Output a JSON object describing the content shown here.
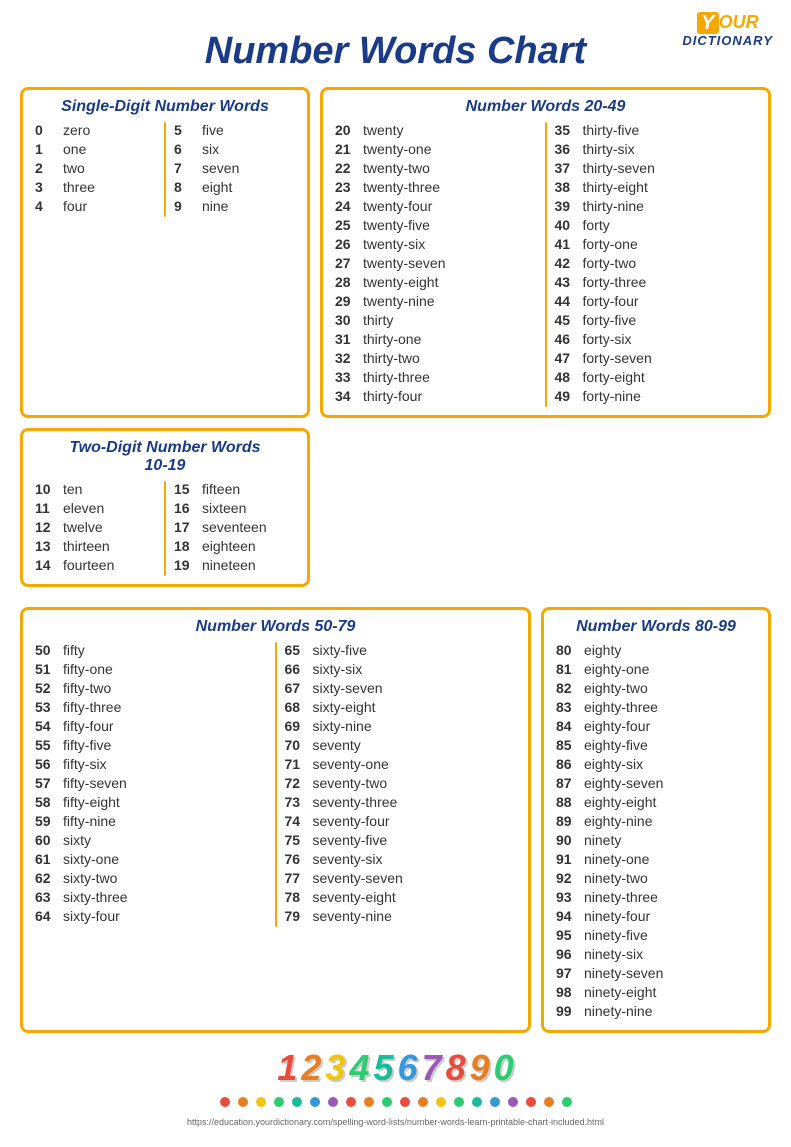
{
  "title": "Number Words Chart",
  "logo": {
    "y": "Y",
    "our": "OUR",
    "dictionary": "DICTIONARY"
  },
  "sections": {
    "single_digit": {
      "title": "Single-Digit Number Words",
      "left": [
        {
          "num": "0",
          "word": "zero"
        },
        {
          "num": "1",
          "word": "one"
        },
        {
          "num": "2",
          "word": "two"
        },
        {
          "num": "3",
          "word": "three"
        },
        {
          "num": "4",
          "word": "four"
        }
      ],
      "right": [
        {
          "num": "5",
          "word": "five"
        },
        {
          "num": "6",
          "word": "six"
        },
        {
          "num": "7",
          "word": "seven"
        },
        {
          "num": "8",
          "word": "eight"
        },
        {
          "num": "9",
          "word": "nine"
        }
      ]
    },
    "two_digit": {
      "title": "Two-Digit Number Words\n10-19",
      "left": [
        {
          "num": "10",
          "word": "ten"
        },
        {
          "num": "11",
          "word": "eleven"
        },
        {
          "num": "12",
          "word": "twelve"
        },
        {
          "num": "13",
          "word": "thirteen"
        },
        {
          "num": "14",
          "word": "fourteen"
        }
      ],
      "right": [
        {
          "num": "15",
          "word": "fifteen"
        },
        {
          "num": "16",
          "word": "sixteen"
        },
        {
          "num": "17",
          "word": "seventeen"
        },
        {
          "num": "18",
          "word": "eighteen"
        },
        {
          "num": "19",
          "word": "nineteen"
        }
      ]
    },
    "twenty_49": {
      "title": "Number Words 20-49",
      "left": [
        {
          "num": "20",
          "word": "twenty"
        },
        {
          "num": "21",
          "word": "twenty-one"
        },
        {
          "num": "22",
          "word": "twenty-two"
        },
        {
          "num": "23",
          "word": "twenty-three"
        },
        {
          "num": "24",
          "word": "twenty-four"
        },
        {
          "num": "25",
          "word": "twenty-five"
        },
        {
          "num": "26",
          "word": "twenty-six"
        },
        {
          "num": "27",
          "word": "twenty-seven"
        },
        {
          "num": "28",
          "word": "twenty-eight"
        },
        {
          "num": "29",
          "word": "twenty-nine"
        },
        {
          "num": "30",
          "word": "thirty"
        },
        {
          "num": "31",
          "word": "thirty-one"
        },
        {
          "num": "32",
          "word": "thirty-two"
        },
        {
          "num": "33",
          "word": "thirty-three"
        },
        {
          "num": "34",
          "word": "thirty-four"
        }
      ],
      "right": [
        {
          "num": "35",
          "word": "thirty-five"
        },
        {
          "num": "36",
          "word": "thirty-six"
        },
        {
          "num": "37",
          "word": "thirty-seven"
        },
        {
          "num": "38",
          "word": "thirty-eight"
        },
        {
          "num": "39",
          "word": "thirty-nine"
        },
        {
          "num": "40",
          "word": "forty"
        },
        {
          "num": "41",
          "word": "forty-one"
        },
        {
          "num": "42",
          "word": "forty-two"
        },
        {
          "num": "43",
          "word": "forty-three"
        },
        {
          "num": "44",
          "word": "forty-four"
        },
        {
          "num": "45",
          "word": "forty-five"
        },
        {
          "num": "46",
          "word": "forty-six"
        },
        {
          "num": "47",
          "word": "forty-seven"
        },
        {
          "num": "48",
          "word": "forty-eight"
        },
        {
          "num": "49",
          "word": "forty-nine"
        }
      ]
    },
    "fifty_79": {
      "title": "Number Words 50-79",
      "left": [
        {
          "num": "50",
          "word": "fifty"
        },
        {
          "num": "51",
          "word": "fifty-one"
        },
        {
          "num": "52",
          "word": "fifty-two"
        },
        {
          "num": "53",
          "word": "fifty-three"
        },
        {
          "num": "54",
          "word": "fifty-four"
        },
        {
          "num": "55",
          "word": "fifty-five"
        },
        {
          "num": "56",
          "word": "fifty-six"
        },
        {
          "num": "57",
          "word": "fifty-seven"
        },
        {
          "num": "58",
          "word": "fifty-eight"
        },
        {
          "num": "59",
          "word": "fifty-nine"
        },
        {
          "num": "60",
          "word": "sixty"
        },
        {
          "num": "61",
          "word": "sixty-one"
        },
        {
          "num": "62",
          "word": "sixty-two"
        },
        {
          "num": "63",
          "word": "sixty-three"
        },
        {
          "num": "64",
          "word": "sixty-four"
        }
      ],
      "right": [
        {
          "num": "65",
          "word": "sixty-five"
        },
        {
          "num": "66",
          "word": "sixty-six"
        },
        {
          "num": "67",
          "word": "sixty-seven"
        },
        {
          "num": "68",
          "word": "sixty-eight"
        },
        {
          "num": "69",
          "word": "sixty-nine"
        },
        {
          "num": "70",
          "word": "seventy"
        },
        {
          "num": "71",
          "word": "seventy-one"
        },
        {
          "num": "72",
          "word": "seventy-two"
        },
        {
          "num": "73",
          "word": "seventy-three"
        },
        {
          "num": "74",
          "word": "seventy-four"
        },
        {
          "num": "75",
          "word": "seventy-five"
        },
        {
          "num": "76",
          "word": "seventy-six"
        },
        {
          "num": "77",
          "word": "seventy-seven"
        },
        {
          "num": "78",
          "word": "seventy-eight"
        },
        {
          "num": "79",
          "word": "seventy-nine"
        }
      ]
    },
    "eighty_99": {
      "title": "Number Words 80-99",
      "items": [
        {
          "num": "80",
          "word": "eighty"
        },
        {
          "num": "81",
          "word": "eighty-one"
        },
        {
          "num": "82",
          "word": "eighty-two"
        },
        {
          "num": "83",
          "word": "eighty-three"
        },
        {
          "num": "84",
          "word": "eighty-four"
        },
        {
          "num": "85",
          "word": "eighty-five"
        },
        {
          "num": "86",
          "word": "eighty-six"
        },
        {
          "num": "87",
          "word": "eighty-seven"
        },
        {
          "num": "88",
          "word": "eighty-eight"
        },
        {
          "num": "89",
          "word": "eighty-nine"
        },
        {
          "num": "90",
          "word": "ninety"
        },
        {
          "num": "91",
          "word": "ninety-one"
        },
        {
          "num": "92",
          "word": "ninety-two"
        },
        {
          "num": "93",
          "word": "ninety-three"
        },
        {
          "num": "94",
          "word": "ninety-four"
        },
        {
          "num": "95",
          "word": "ninety-five"
        },
        {
          "num": "96",
          "word": "ninety-six"
        },
        {
          "num": "97",
          "word": "ninety-seven"
        },
        {
          "num": "98",
          "word": "ninety-eight"
        },
        {
          "num": "99",
          "word": "ninety-nine"
        }
      ]
    }
  },
  "decoration": {
    "numbers": [
      "1",
      "2",
      "3",
      "4",
      "5",
      "6",
      "7",
      "8",
      "9",
      "0"
    ],
    "colors": [
      "#e74c3c",
      "#e67e22",
      "#f1c40f",
      "#2ecc71",
      "#1abc9c",
      "#3498db",
      "#9b59b6",
      "#e74c3c",
      "#e67e22",
      "#2ecc71"
    ]
  },
  "footer_url": "https://education.yourdictionary.com/spelling-word-lists/number-words-learn-printable-chart-included.html"
}
